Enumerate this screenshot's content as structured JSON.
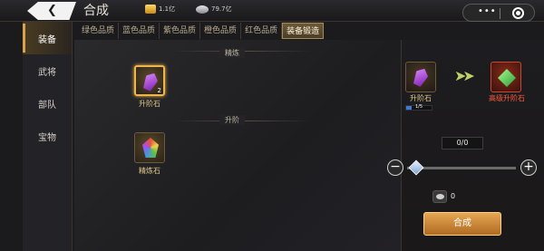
{
  "header": {
    "title": "合成",
    "gold_amount": "1.1亿",
    "silver_amount": "79.7亿"
  },
  "sidebar": {
    "items": [
      {
        "label": "装备"
      },
      {
        "label": "武将"
      },
      {
        "label": "部队"
      },
      {
        "label": "宝物"
      }
    ]
  },
  "tabs": [
    {
      "label": "绿色品质"
    },
    {
      "label": "蓝色品质"
    },
    {
      "label": "紫色品质"
    },
    {
      "label": "橙色品质"
    },
    {
      "label": "红色品质"
    },
    {
      "label": "装备锻造"
    }
  ],
  "content": {
    "section1_title": "精炼",
    "section2_title": "升阶",
    "item1": {
      "label": "升阶石",
      "count": "2"
    },
    "item2": {
      "label": "精炼石"
    }
  },
  "right_panel": {
    "source_label": "升阶石",
    "source_progress": "1/5",
    "source_progress_fraction": 0.2,
    "target_label": "高级升阶石",
    "quantity": "0/0",
    "cost": "0",
    "craft_button": "合成"
  }
}
